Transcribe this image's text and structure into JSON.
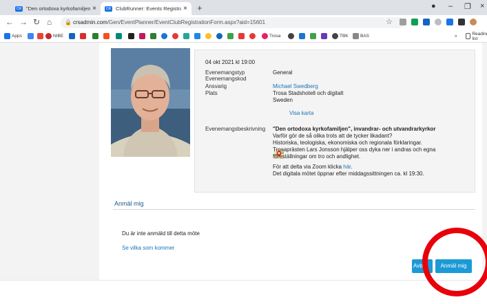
{
  "browser": {
    "tabs": [
      {
        "title": "\"Den ortodoxa kyrkofamiljen\" | Tr",
        "active": false
      },
      {
        "title": "ClubRunner: Events Registration",
        "active": true
      }
    ],
    "url_host": "crsadmin.com",
    "url_path": "/Gen/EventPlanner/EventClubRegistrationForm.aspx?aid=15601",
    "bookmarks": [
      {
        "label": "Apps",
        "color": "#1a73e8"
      },
      {
        "label": "NIBE",
        "color": "#c62828"
      },
      {
        "label": "Trosa",
        "color": "#e91e63"
      },
      {
        "label": "TBK",
        "color": "#444444"
      },
      {
        "label": "BAS",
        "color": "#888888"
      }
    ],
    "reading_list": "Reading list"
  },
  "event": {
    "datetime": "04 okt 2021 kl 19:00",
    "labels": {
      "type": "Evenemangstyp",
      "code": "Evenemangskod",
      "responsible": "Ansvarig",
      "place": "Plats",
      "description": "Evenemangsbeskrivning"
    },
    "type": "General",
    "responsible": "Michael Swedberg",
    "place_lines": [
      "Trosa Stadshotell och digitalt",
      "Sweden"
    ],
    "map_link": "Visa karta",
    "description": {
      "title": "\"Den ortodoxa kyrkofamiljen\", invandrar- och utvandrarkyrkor",
      "lines": [
        "Varför gör de så olika trots att de tycker likadant?",
        "Historiska, teologiska, ekonomiska och regionala förklaringar.",
        "Trosaprästen Lars Jonsson hjälper oss dyka ner i andras och egna",
        "föreställningar om tro och andlighet."
      ],
      "zoom_prefix": "För att delta via Zoom klicka ",
      "zoom_link": "här",
      "zoom_suffix": ".",
      "digital_note": "Det digitala mötet öppnar efter middagssittningen ca. kl 19:30."
    }
  },
  "registration": {
    "section_title": "Anmäl mig",
    "status": "Du är inte anmäld till detta möte",
    "see_who": "Se vilka som kommer",
    "cancel_label": "Avb",
    "register_label": "Anmäl mig"
  },
  "colors": {
    "accent": "#1c9ad6",
    "highlight": "#e8000b"
  }
}
